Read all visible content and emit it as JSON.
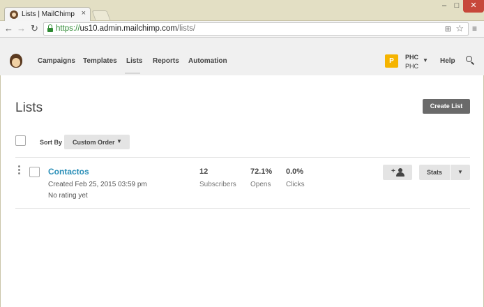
{
  "browser": {
    "tab_title": "Lists | MailChimp",
    "tab_close": "×",
    "window_min": "–",
    "window_max": "□",
    "window_close": "✕",
    "url_scheme": "https://",
    "url_host": "us10.admin.mailchimp.com",
    "url_path": "/lists/",
    "nav_back": "←",
    "nav_forward": "→",
    "nav_reload": "↻",
    "star": "☆",
    "menu": "≡",
    "translate": "⊞"
  },
  "appnav": {
    "items": [
      "Campaigns",
      "Templates",
      "Lists",
      "Reports",
      "Automation"
    ],
    "active": "Lists",
    "account_badge": "P",
    "account_name": "PHC",
    "account_sub": "PHC",
    "help": "Help"
  },
  "page": {
    "title": "Lists",
    "create_button": "Create List",
    "sort_label": "Sort By",
    "sort_value": "Custom Order"
  },
  "lists": [
    {
      "name": "Contactos",
      "created": "Created Feb 25, 2015 03:59 pm",
      "rating": "No rating yet",
      "subscribers": "12",
      "subscribers_label": "Subscribers",
      "opens": "72.1%",
      "opens_label": "Opens",
      "clicks": "0.0%",
      "clicks_label": "Clicks",
      "add_icon_plus": "+",
      "stats_button": "Stats"
    }
  ],
  "colors": {
    "link": "#2b8fb8",
    "account_badge": "#f5b400",
    "primary_button": "#6a6a6a",
    "secure_green": "#2f8a34"
  }
}
